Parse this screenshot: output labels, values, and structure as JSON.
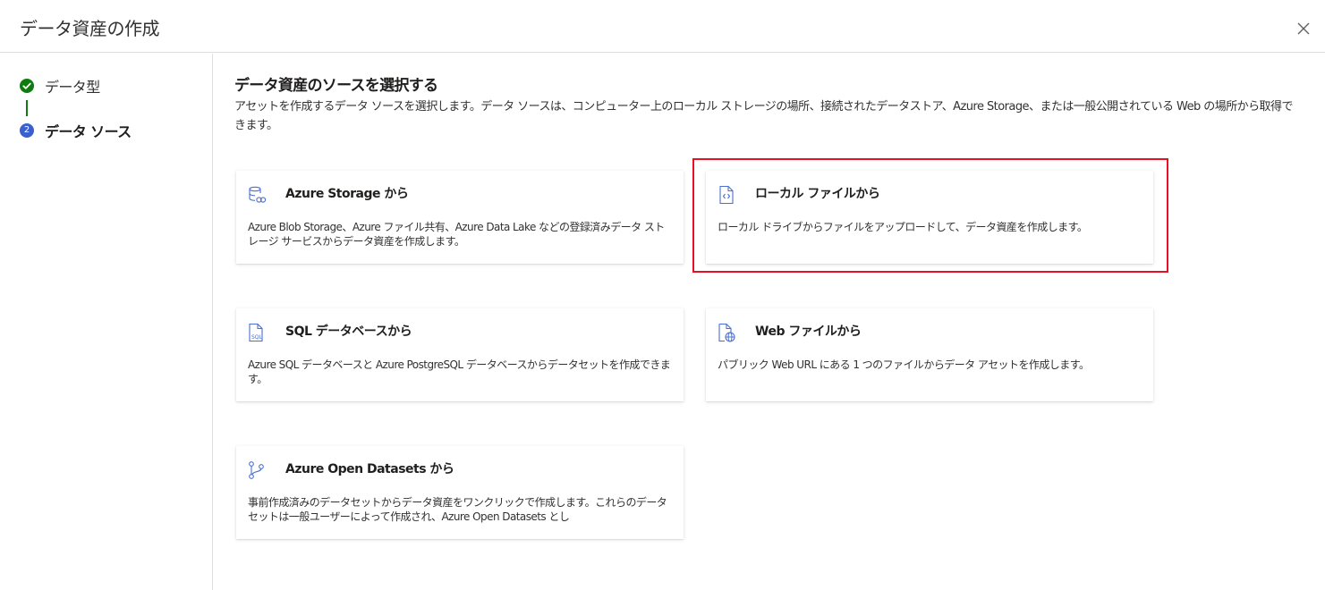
{
  "dialog": {
    "title": "データ資産の作成",
    "close_icon": "close-icon"
  },
  "steps": [
    {
      "label": "データ型",
      "status": "completed",
      "icon": "check-circle-icon"
    },
    {
      "label": "データ ソース",
      "status": "current",
      "number": "2"
    }
  ],
  "main": {
    "heading": "データ資産のソースを選択する",
    "description": "アセットを作成するデータ ソースを選択します。データ ソースは、コンピューター上のローカル ストレージの場所、接続されたデータストア、Azure Storage、または一般公開されている Web の場所から取得できます。",
    "cards": [
      {
        "id": "azure-storage",
        "icon": "storage-icon",
        "title": "Azure Storage から",
        "description": "Azure Blob Storage、Azure ファイル共有、Azure Data Lake などの登録済みデータ ストレージ サービスからデータ資産を作成します。"
      },
      {
        "id": "local-file",
        "icon": "code-file-icon",
        "title": "ローカル ファイルから",
        "description": "ローカル ドライブからファイルをアップロードして、データ資産を作成します。",
        "highlighted": true
      },
      {
        "id": "sql-database",
        "icon": "sql-file-icon",
        "title": "SQL データベースから",
        "description": "Azure SQL データベースと Azure PostgreSQL データベースからデータセットを作成できます。"
      },
      {
        "id": "web-file",
        "icon": "web-file-icon",
        "title": "Web ファイルから",
        "description": "パブリック Web URL にある 1 つのファイルからデータ アセットを作成します。"
      },
      {
        "id": "open-datasets",
        "icon": "branch-icon",
        "title": "Azure Open Datasets から",
        "description": "事前作成済みのデータセットからデータ資産をワンクリックで作成します。これらのデータセットは一般ユーザーによって作成され、Azure Open Datasets とし"
      }
    ]
  },
  "colors": {
    "accent": "#3b5fcc",
    "success": "#107c10",
    "highlight_border": "#e81123",
    "icon_blue": "#4a6fd0"
  }
}
